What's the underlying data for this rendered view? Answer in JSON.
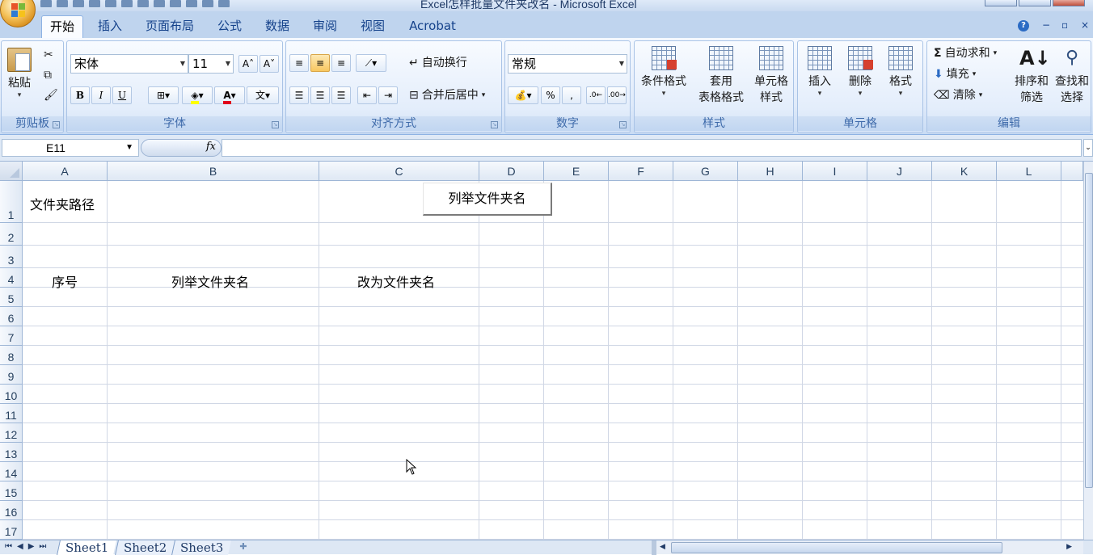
{
  "window": {
    "title": "Excel怎样批量文件夹改名 - Microsoft Excel"
  },
  "tabs": [
    {
      "label": "开始",
      "active": true
    },
    {
      "label": "插入"
    },
    {
      "label": "页面布局"
    },
    {
      "label": "公式"
    },
    {
      "label": "数据"
    },
    {
      "label": "审阅"
    },
    {
      "label": "视图"
    },
    {
      "label": "Acrobat"
    }
  ],
  "ribbon": {
    "clipboard": {
      "paste": "粘贴",
      "label": "剪贴板"
    },
    "font": {
      "name": "宋体",
      "size": "11",
      "label": "字体"
    },
    "alignment": {
      "wrap": "自动换行",
      "merge": "合并后居中",
      "label": "对齐方式"
    },
    "number": {
      "format": "常规",
      "label": "数字"
    },
    "styles": {
      "conditional": "条件格式",
      "table_line1": "套用",
      "table_line2": "表格格式",
      "cell_line1": "单元格",
      "cell_line2": "样式",
      "label": "样式"
    },
    "cells": {
      "insert": "插入",
      "delete": "删除",
      "format": "格式",
      "label": "单元格"
    },
    "editing": {
      "autosum": "自动求和",
      "fill": "填充",
      "clear": "清除",
      "sort_line1": "排序和",
      "sort_line2": "筛选",
      "find_line1": "查找和",
      "find_line2": "选择",
      "label": "编辑"
    }
  },
  "formula_bar": {
    "name_box": "E11",
    "fx": "fx",
    "value": ""
  },
  "columns": [
    "A",
    "B",
    "C",
    "D",
    "E",
    "F",
    "G",
    "H",
    "I",
    "J",
    "K",
    "L"
  ],
  "rows": [
    "1",
    "2",
    "3",
    "4",
    "5",
    "6",
    "7",
    "8",
    "9",
    "10",
    "11",
    "12",
    "13",
    "14",
    "15",
    "16",
    "17"
  ],
  "cells": {
    "A1": "文件夹路径",
    "A4": "序号",
    "B4": "列举文件夹名",
    "C4": "改为文件夹名"
  },
  "sheet_button": "列举文件夹名",
  "sheet_tabs": [
    {
      "label": "Sheet1",
      "active": true
    },
    {
      "label": "Sheet2"
    },
    {
      "label": "Sheet3"
    }
  ]
}
